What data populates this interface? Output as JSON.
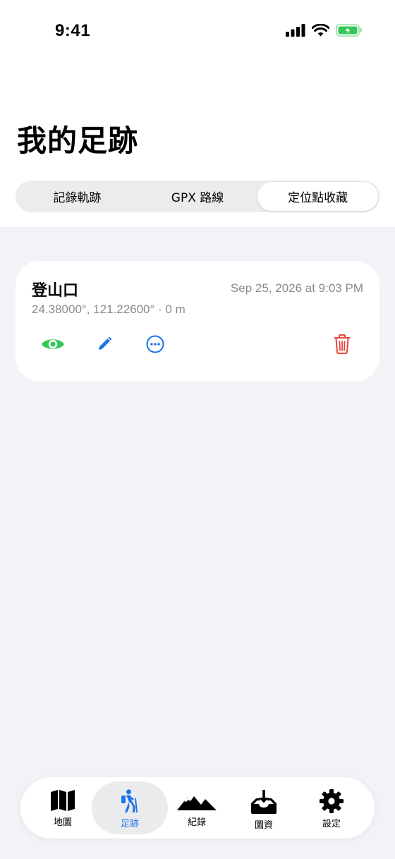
{
  "status_bar": {
    "time": "9:41"
  },
  "header": {
    "title": "我的足跡"
  },
  "segments": [
    {
      "label": "記錄軌跡",
      "active": false
    },
    {
      "label": "GPX 路線",
      "active": false
    },
    {
      "label": "定位點收藏",
      "active": true
    }
  ],
  "card": {
    "title": "登山口",
    "date": "Sep 25, 2026 at 9:03 PM",
    "coords": "24.38000°, 121.22600°  ·  0 m",
    "actions": [
      {
        "icon": "eye-icon",
        "color": "#34c759"
      },
      {
        "icon": "pencil-icon",
        "color": "#1a73e8"
      },
      {
        "icon": "ellipsis-circle-icon",
        "color": "#1a73e8"
      },
      {
        "icon": "trash-icon",
        "color": "#e5483f"
      }
    ]
  },
  "tabbar": {
    "tabs": [
      {
        "label": "地圖",
        "icon": "map-icon"
      },
      {
        "label": "足跡",
        "icon": "hiker-icon",
        "selected": true
      },
      {
        "label": "紀錄",
        "icon": "mountains-icon"
      },
      {
        "label": "圖資",
        "icon": "tray-download-icon"
      },
      {
        "label": "設定",
        "icon": "gear-icon"
      }
    ]
  },
  "colors": {
    "accent": "#1a73e8",
    "green": "#34c759",
    "red": "#e5483f",
    "battery": "#34c759"
  }
}
